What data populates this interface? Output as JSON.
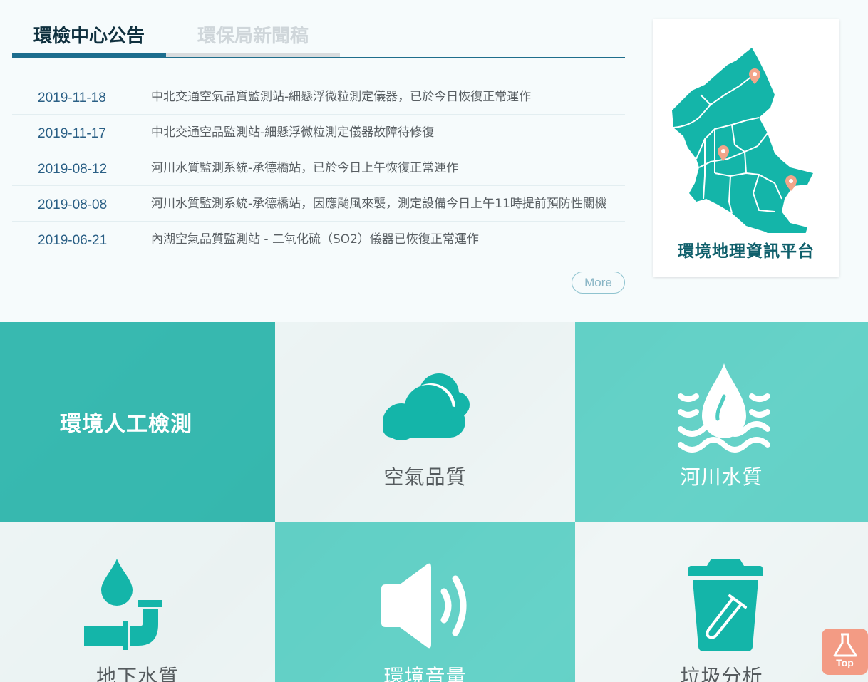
{
  "tabs": [
    {
      "label": "環檢中心公告",
      "active": true
    },
    {
      "label": "環保局新聞稿",
      "active": false
    }
  ],
  "news": [
    {
      "date": "2019-11-18",
      "title": "中北交通空氣品質監測站-細懸浮微粒測定儀器，已於今日恢復正常運作"
    },
    {
      "date": "2019-11-17",
      "title": "中北交通空品監測站-細懸浮微粒測定儀器故障待修復"
    },
    {
      "date": "2019-08-12",
      "title": "河川水質監測系統-承德橋站，已於今日上午恢復正常運作"
    },
    {
      "date": "2019-08-08",
      "title": "河川水質監測系統-承德橋站，因應颱風來襲，測定設備今日上午11時提前預防性關機"
    },
    {
      "date": "2019-06-21",
      "title": "內湖空氣品質監測站 - 二氧化硫（SO2）儀器已恢復正常運作"
    }
  ],
  "more_label": "More",
  "map_card": {
    "title": "環境地理資訊平台",
    "icon": "taipei-map-icon"
  },
  "tiles": [
    {
      "label": "環境人工檢測",
      "icon": ""
    },
    {
      "label": "空氣品質",
      "icon": "cloud-icon"
    },
    {
      "label": "河川水質",
      "icon": "water-drop-waves-icon"
    },
    {
      "label": "地下水質",
      "icon": "pipe-drop-icon"
    },
    {
      "label": "環境音量",
      "icon": "speaker-icon"
    },
    {
      "label": "垃圾分析",
      "icon": "trash-bin-icon"
    }
  ],
  "top_button": {
    "label": "Top",
    "icon": "flask-icon"
  },
  "colors": {
    "brand_teal": "#21b2a7",
    "navy": "#1c6d8e",
    "accent_pin": "#f2a58a",
    "top_button": "#f39b84"
  }
}
